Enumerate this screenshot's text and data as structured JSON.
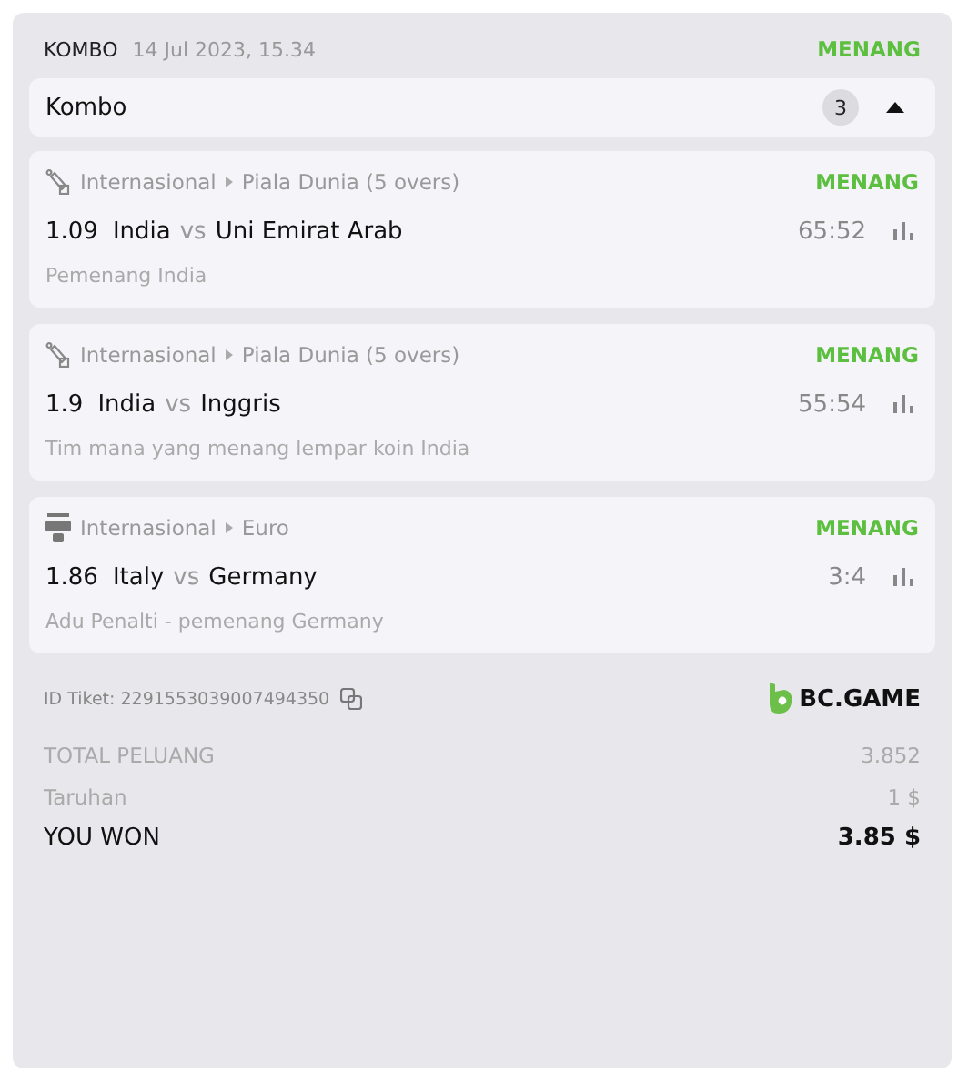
{
  "header": {
    "type": "KOMBO",
    "date": "14 Jul 2023, 15.34",
    "status": "MENANG"
  },
  "combo": {
    "title": "Kombo",
    "count": "3",
    "expanded": true
  },
  "bets": [
    {
      "kind": "cricket",
      "category": "Internasional",
      "league": "Piala Dunia (5 overs)",
      "status": "MENANG",
      "odds": "1.09",
      "home": "India",
      "vs": "vs",
      "away": "Uni Emirat Arab",
      "score": "65:52",
      "market": "Pemenang India"
    },
    {
      "kind": "cricket",
      "category": "Internasional",
      "league": "Piala Dunia (5 overs)",
      "status": "MENANG",
      "odds": "1.9",
      "home": "India",
      "vs": "vs",
      "away": "Inggris",
      "score": "55:54",
      "market": "Tim mana yang menang lempar koin India"
    },
    {
      "kind": "penalty",
      "category": "Internasional",
      "league": "Euro",
      "status": "MENANG",
      "odds": "1.86",
      "home": "Italy",
      "vs": "vs",
      "away": "Germany",
      "score": "3:4",
      "market": "Adu Penalti - pemenang Germany"
    }
  ],
  "ticket": {
    "id": "ID Tiket: 2291553039007494350",
    "brand": "BC.GAME"
  },
  "totals": [
    {
      "label": "TOTAL PELUANG",
      "value": "3.852",
      "kind": "muted"
    },
    {
      "label": "Taruhan",
      "value": "1 $",
      "kind": "muted"
    },
    {
      "label": "YOU WON",
      "value": "3.85 $",
      "kind": "strong"
    }
  ]
}
